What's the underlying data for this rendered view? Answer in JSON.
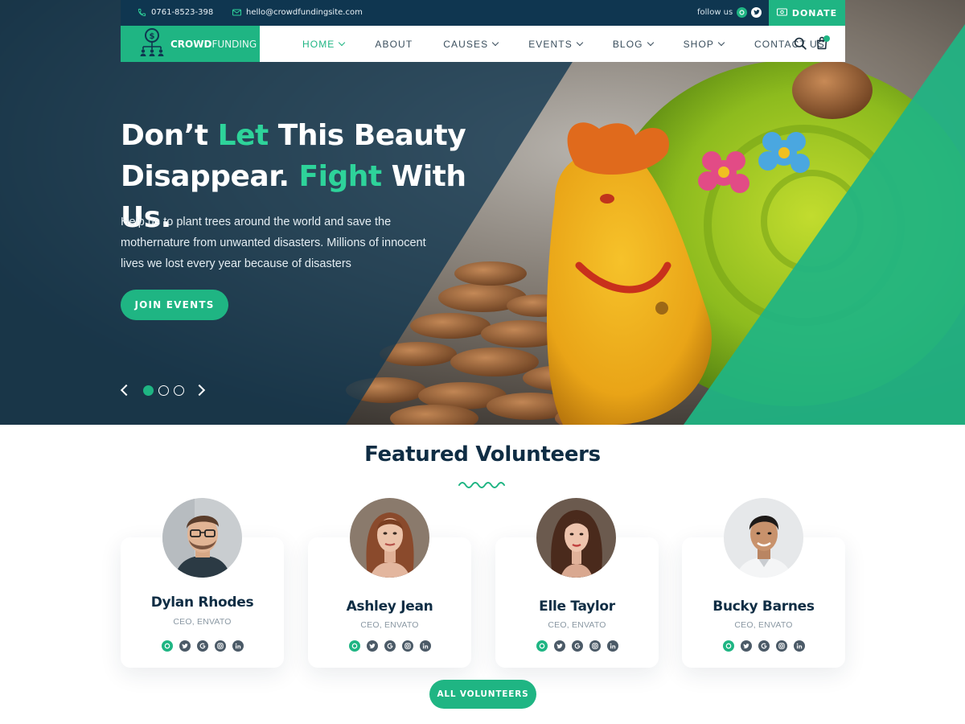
{
  "topbar": {
    "phone": "0761-8523-398",
    "email": "hello@crowdfundingsite.com",
    "follow_label": "follow us",
    "donate_label": "DONATE"
  },
  "nav": {
    "logo_bold": "CROWD",
    "logo_light": "FUNDING",
    "items": [
      {
        "label": "HOME",
        "dropdown": true,
        "active": true
      },
      {
        "label": "ABOUT",
        "dropdown": false
      },
      {
        "label": "CAUSES",
        "dropdown": true
      },
      {
        "label": "EVENTS",
        "dropdown": true
      },
      {
        "label": "BLOG",
        "dropdown": true
      },
      {
        "label": "SHOP",
        "dropdown": true
      },
      {
        "label": "CONTACT US",
        "dropdown": false
      }
    ]
  },
  "hero": {
    "title_line1_a": "Don’t ",
    "title_line1_b": "Let",
    "title_line1_c": " This Beauty",
    "title_line2_a": "Disappear. ",
    "title_line2_b": "Fight",
    "title_line2_c": " With Us.",
    "description": "Help us to plant trees around the world and save the mothernature from unwanted disasters. Millions of innocent lives we lost every year because of disasters",
    "cta": "JOIN EVENTS",
    "slides_total": 3,
    "active_slide": 1
  },
  "volunteers": {
    "title": "Featured Volunteers",
    "members": [
      {
        "name": "Dylan Rhodes",
        "role": "CEO, ENVATO"
      },
      {
        "name": "Ashley Jean",
        "role": "CEO, ENVATO"
      },
      {
        "name": "Elle Taylor",
        "role": "CEO, ENVATO"
      },
      {
        "name": "Bucky Barnes",
        "role": "CEO, ENVATO"
      }
    ],
    "social_icons": [
      "facebook-icon",
      "twitter-icon",
      "google-icon",
      "instagram-icon",
      "linkedin-icon"
    ],
    "all_button": "ALL VOLUNTEERS"
  },
  "colors": {
    "accent": "#1fb583",
    "navy": "#0f3650",
    "heading": "#0f2d44"
  }
}
